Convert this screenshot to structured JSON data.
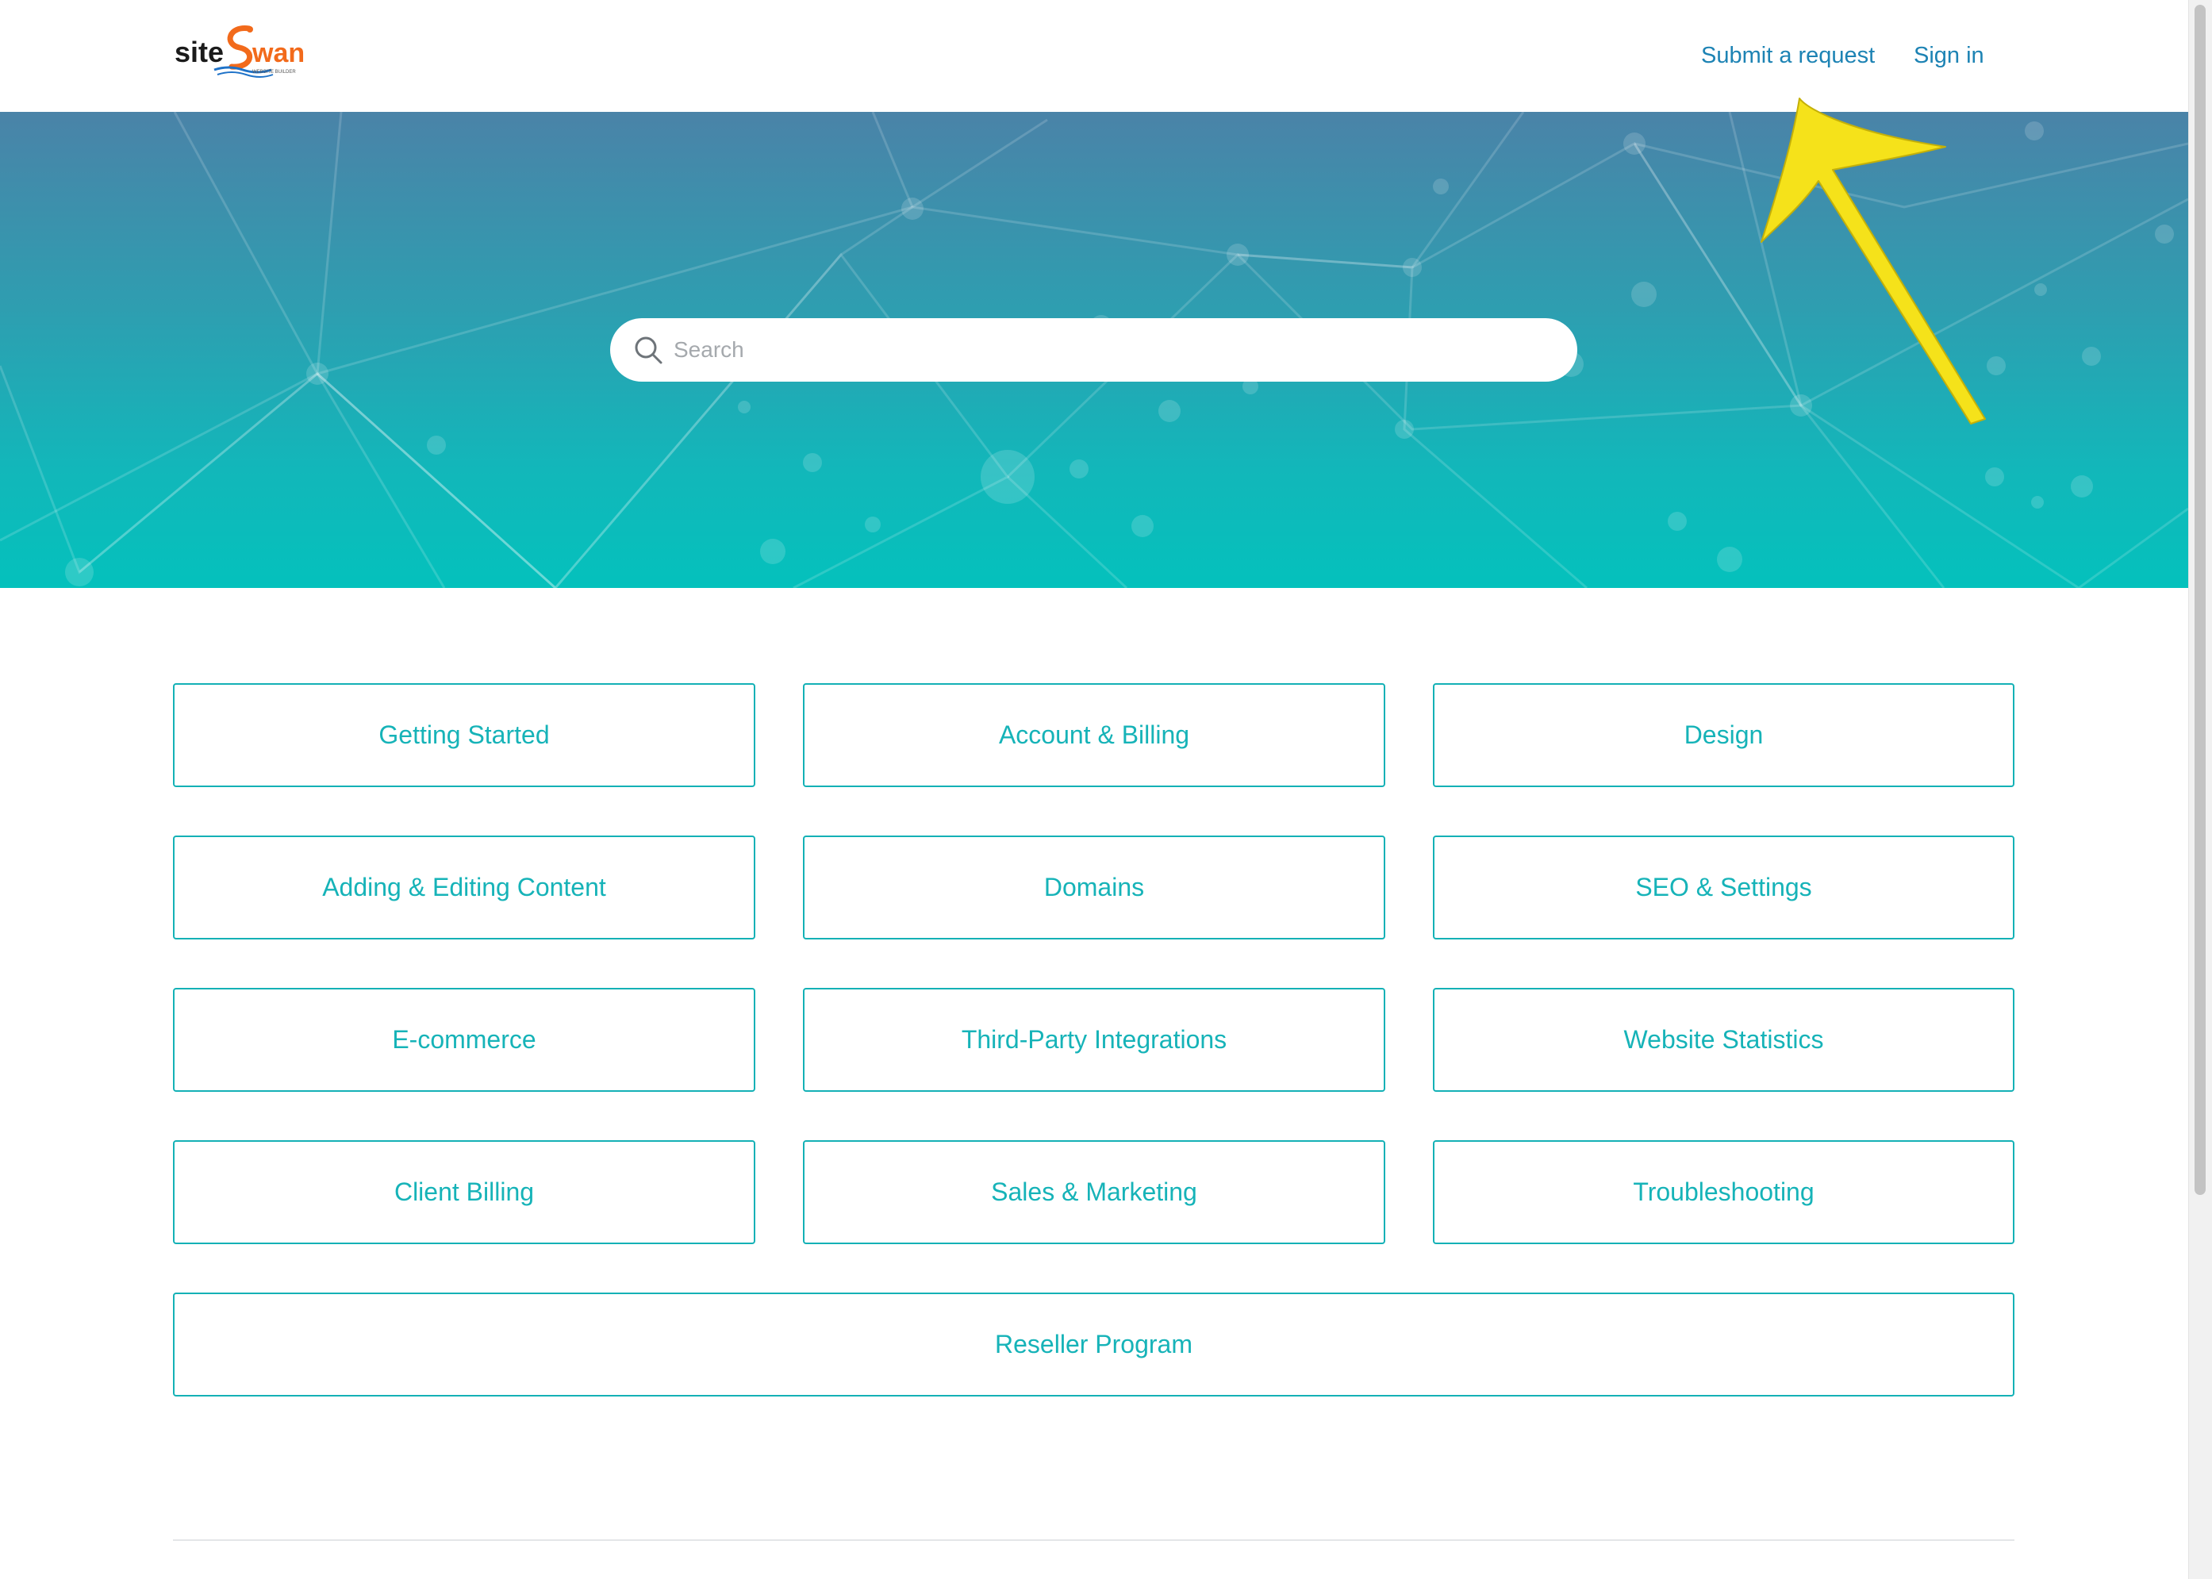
{
  "brand": {
    "logo_text_dark": "site",
    "logo_text_accent": "Swan",
    "logo_tagline": "WEBSITE BUILDER",
    "accent_color": "#f26a1b",
    "dark_color": "#1b1b1b"
  },
  "header": {
    "submit_request": "Submit a request",
    "sign_in": "Sign in"
  },
  "search": {
    "placeholder": "Search",
    "value": ""
  },
  "categories": [
    {
      "label": "Getting Started"
    },
    {
      "label": "Account & Billing"
    },
    {
      "label": "Design"
    },
    {
      "label": "Adding & Editing Content"
    },
    {
      "label": "Domains"
    },
    {
      "label": "SEO & Settings"
    },
    {
      "label": "E-commerce"
    },
    {
      "label": "Third-Party Integrations"
    },
    {
      "label": "Website Statistics"
    },
    {
      "label": "Client Billing"
    },
    {
      "label": "Sales & Marketing"
    },
    {
      "label": "Troubleshooting"
    },
    {
      "label": "Reseller Program"
    }
  ],
  "colors": {
    "link": "#1d83b4",
    "category_text": "#16b3b8",
    "category_border": "#14b1b6",
    "hero_top": "#4a83a8",
    "hero_bottom": "#04c1bc",
    "annotation_arrow": "#f5e21a"
  },
  "icons": {
    "search": "search-icon",
    "annotation": "arrow-annotation-icon"
  }
}
